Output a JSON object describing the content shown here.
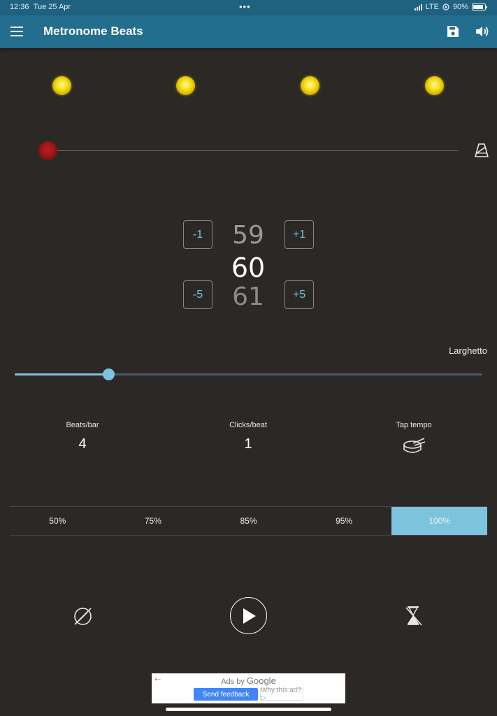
{
  "status_bar": {
    "time": "12:36",
    "date": "Tue 25 Apr",
    "dots": "•••",
    "network": "LTE",
    "battery_text": "90%",
    "battery_level": 0.9
  },
  "app_bar": {
    "title": "Metronome Beats",
    "color": "#236e8e"
  },
  "beats": {
    "count": 4,
    "color": "#f5dd10"
  },
  "pendulum": {
    "color": "#8e1414"
  },
  "bpm": {
    "previous": "59",
    "current": "60",
    "next": "61",
    "minus1": "-1",
    "plus1": "+1",
    "minus5": "-5",
    "plus5": "+5"
  },
  "tempo": {
    "name": "Larghetto",
    "slider_fraction": 0.2,
    "accent": "#7cc4de"
  },
  "settings": {
    "beats_per_bar_label": "Beats/bar",
    "beats_per_bar_value": "4",
    "clicks_per_beat_label": "Clicks/beat",
    "clicks_per_beat_value": "1",
    "tap_tempo_label": "Tap tempo"
  },
  "percentages": [
    {
      "label": "50%",
      "active": false
    },
    {
      "label": "75%",
      "active": false
    },
    {
      "label": "85%",
      "active": false
    },
    {
      "label": "95%",
      "active": false
    },
    {
      "label": "100%",
      "active": true
    }
  ],
  "controls": {
    "left_icon": "no-accent-icon",
    "center_icon": "play-icon",
    "right_icon": "timer-off-icon"
  },
  "ad": {
    "ads_by": "Ads by ",
    "google": "Google",
    "send_feedback": "Send feedback",
    "why_this_ad": "Why this ad? ▷"
  }
}
